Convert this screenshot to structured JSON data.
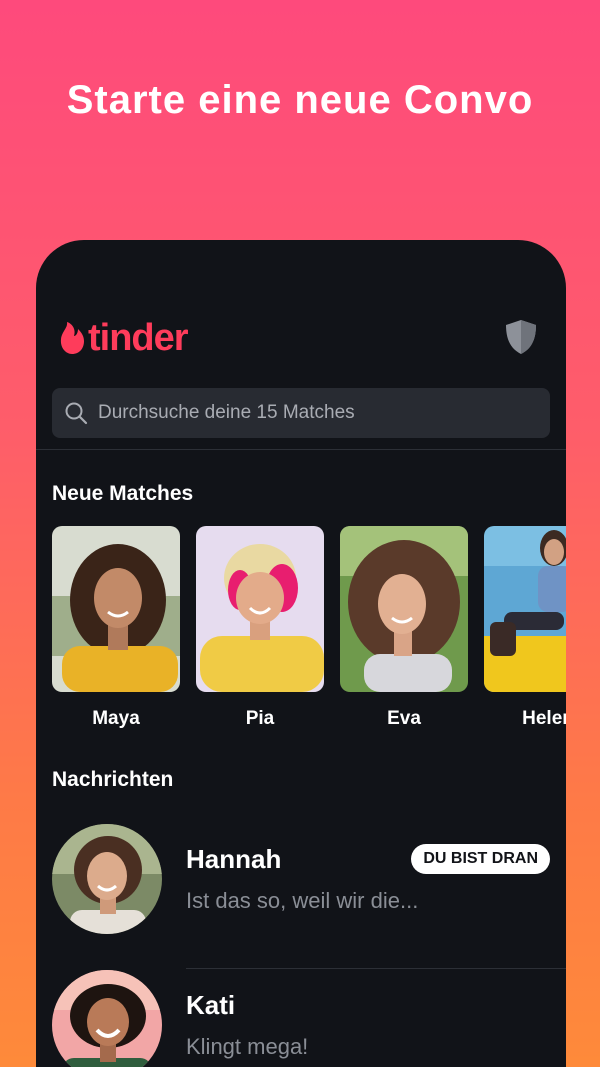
{
  "headline": "Starte eine neue Convo",
  "app": {
    "logo_text": "tinder",
    "brand_color": "#fe3c5b",
    "safety_icon": "shield-icon"
  },
  "search": {
    "placeholder": "Durchsuche deine 15 Matches"
  },
  "new_matches": {
    "title": "Neue Matches",
    "items": [
      {
        "name": "Maya"
      },
      {
        "name": "Pia"
      },
      {
        "name": "Eva"
      },
      {
        "name": "Helen"
      }
    ]
  },
  "messages": {
    "title": "Nachrichten",
    "items": [
      {
        "name": "Hannah",
        "preview": "Ist das so, weil wir die...",
        "badge": "DU BIST DRAN"
      },
      {
        "name": "Kati",
        "preview": "Klingt mega!"
      }
    ]
  }
}
